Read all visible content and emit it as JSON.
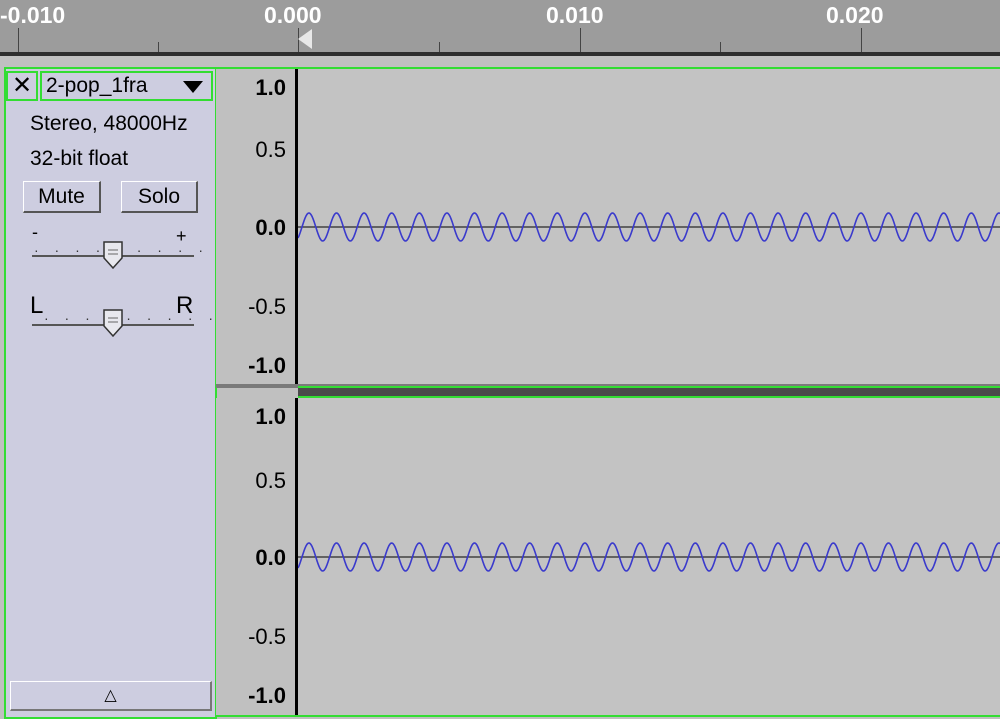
{
  "ruler": {
    "labels": [
      "-0.010",
      "0.000",
      "0.010",
      "0.020"
    ]
  },
  "track": {
    "close_glyph": "✕",
    "name": "2-pop_1fra",
    "info_format": "Stereo, 48000Hz",
    "info_bits": "32-bit float",
    "mute_label": "Mute",
    "solo_label": "Solo",
    "gain_minus": "-",
    "gain_plus": "+",
    "pan_left": "L",
    "pan_right": "R",
    "gain_level": 0.5,
    "pan_level": 0.5,
    "collapse_glyph": "△"
  },
  "vertical_scale": {
    "labels": [
      "1.0",
      "0.5",
      "0.0",
      "-0.5",
      "-1.0"
    ]
  },
  "colors": {
    "waveform": "#3a3acc",
    "selection_border": "#33dd33",
    "panel_bg": "#cdcde0"
  }
}
